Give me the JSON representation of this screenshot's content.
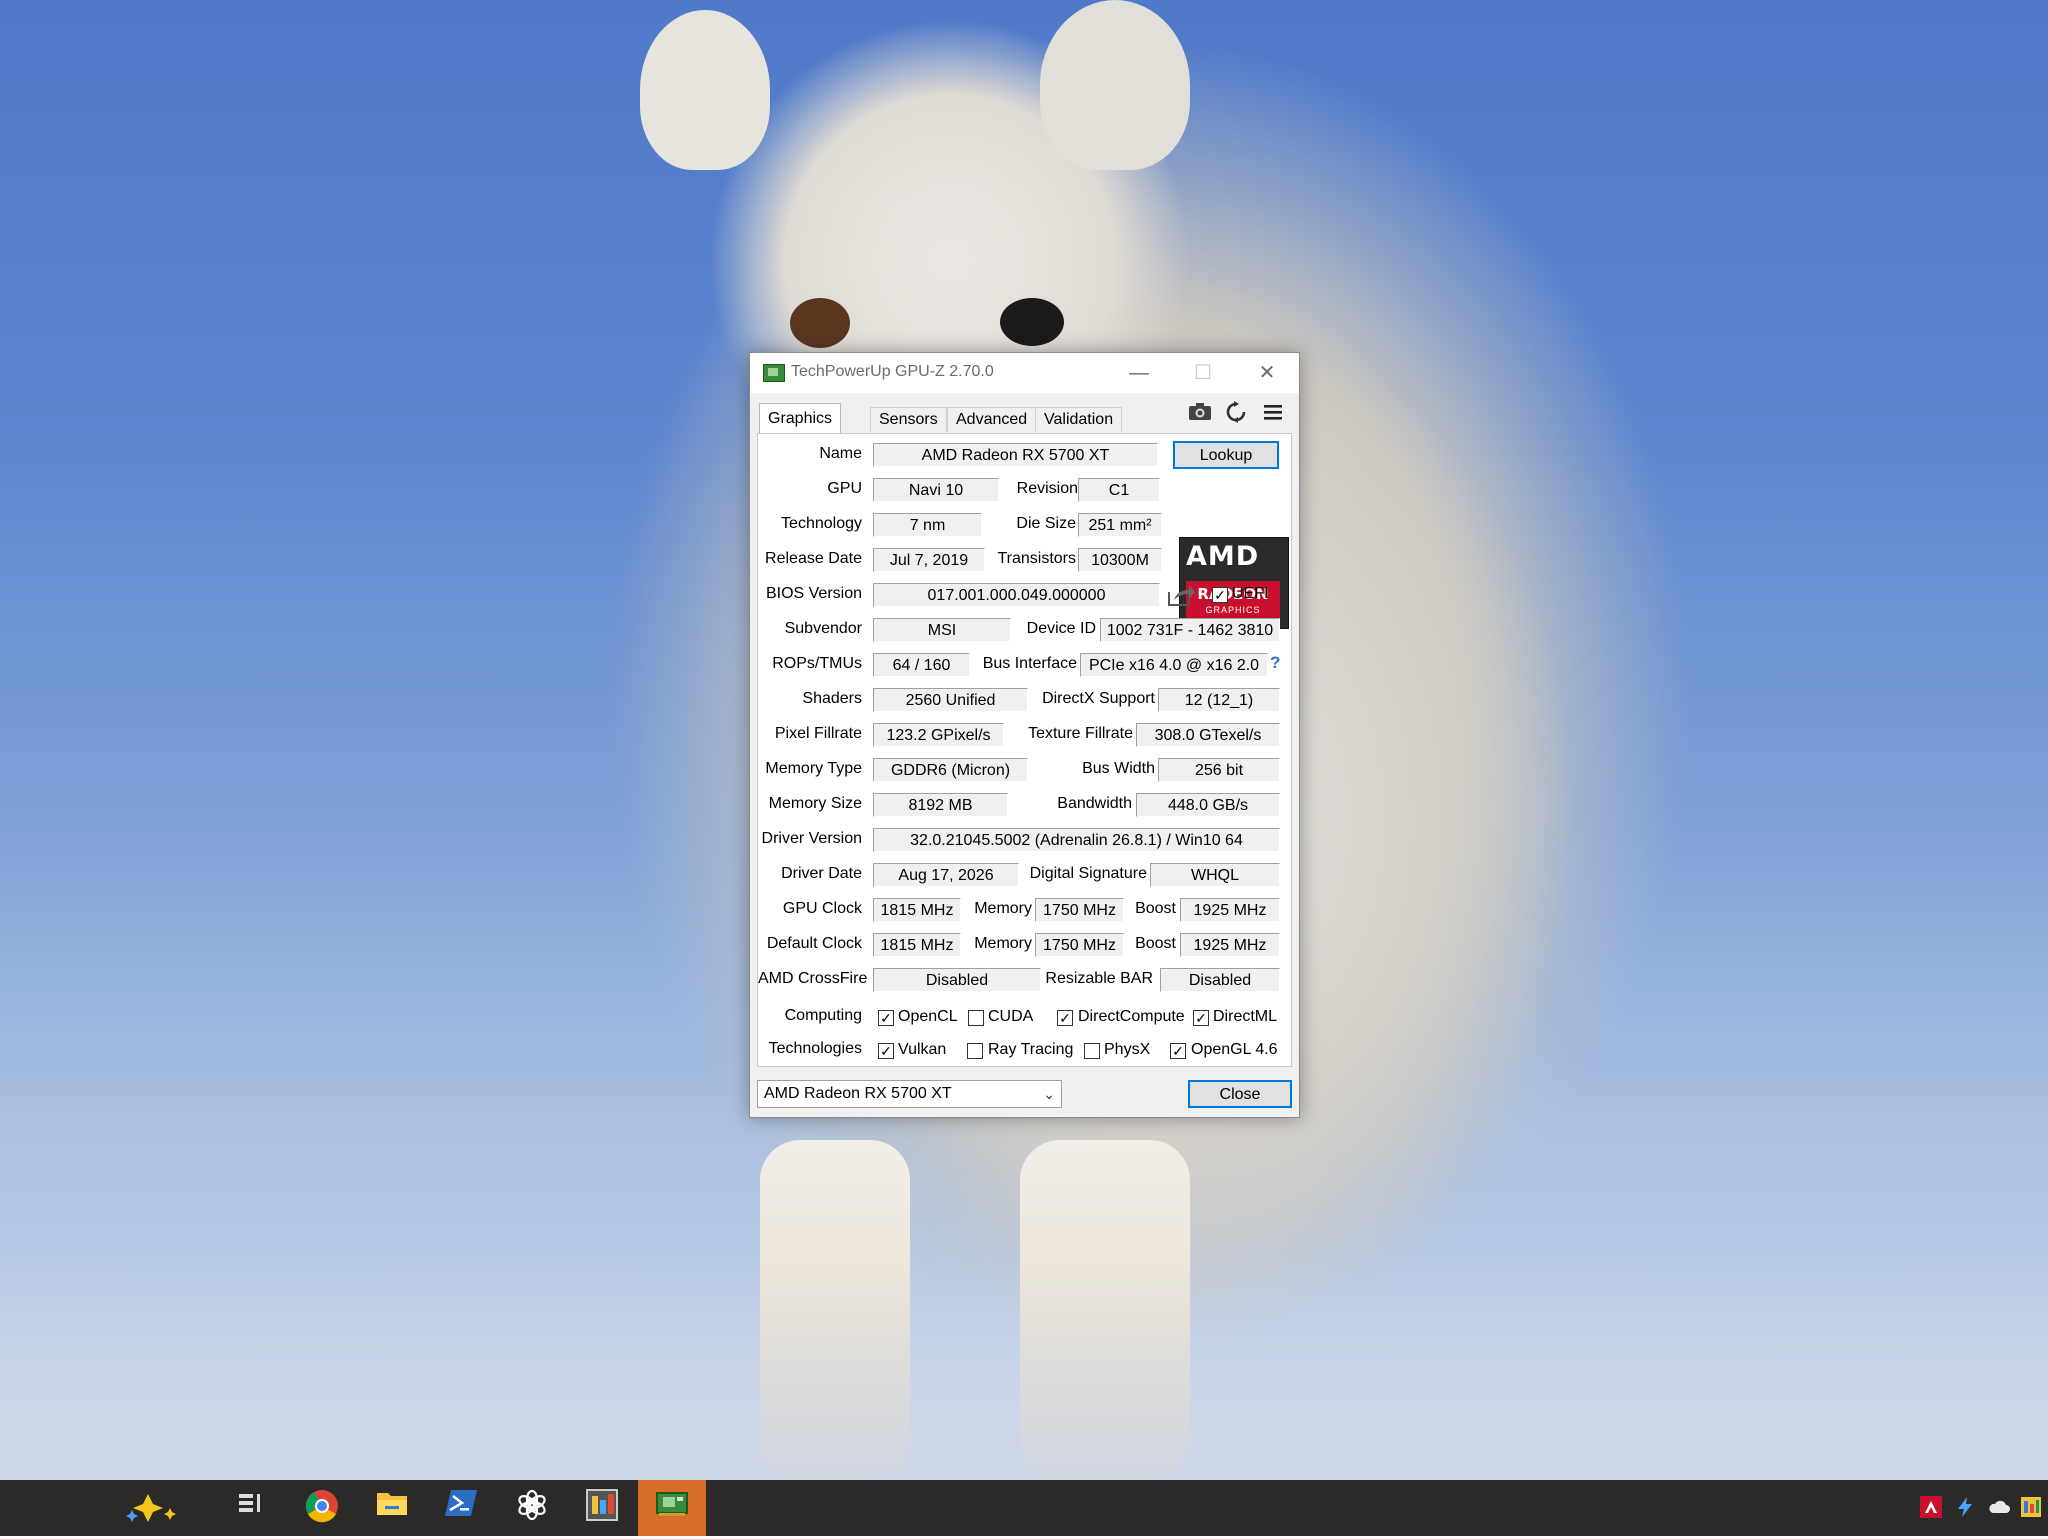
{
  "window": {
    "title": "TechPowerUp GPU-Z 2.70.0",
    "minimize_glyph": "—",
    "maximize_glyph": "☐",
    "close_glyph": "✕"
  },
  "tabs": [
    "Graphics Card",
    "Sensors",
    "Advanced",
    "Validation"
  ],
  "toolbar_icons": [
    "camera-icon",
    "refresh-icon",
    "menu-icon"
  ],
  "fields": {
    "name": {
      "label": "Name",
      "value": "AMD Radeon RX 5700 XT"
    },
    "lookup_button": "Lookup",
    "gpu": {
      "label": "GPU",
      "value": "Navi 10"
    },
    "revision": {
      "label": "Revision",
      "value": "C1"
    },
    "technology": {
      "label": "Technology",
      "value": "7 nm"
    },
    "die_size": {
      "label": "Die Size",
      "value": "251 mm²"
    },
    "release_date": {
      "label": "Release Date",
      "value": "Jul 7, 2019"
    },
    "transistors": {
      "label": "Transistors",
      "value": "10300M"
    },
    "bios_version": {
      "label": "BIOS Version",
      "value": "017.001.000.049.000000"
    },
    "uefi": {
      "label": "UEFI",
      "checked": true
    },
    "subvendor": {
      "label": "Subvendor",
      "value": "MSI"
    },
    "device_id": {
      "label": "Device ID",
      "value": "1002 731F - 1462 3810"
    },
    "rops_tmus": {
      "label": "ROPs/TMUs",
      "value": "64 / 160"
    },
    "bus_interface": {
      "label": "Bus Interface",
      "value": "PCIe x16 4.0 @ x16 2.0",
      "help": "?"
    },
    "shaders": {
      "label": "Shaders",
      "value": "2560 Unified"
    },
    "directx_support": {
      "label": "DirectX Support",
      "value": "12 (12_1)"
    },
    "pixel_fillrate": {
      "label": "Pixel Fillrate",
      "value": "123.2 GPixel/s"
    },
    "texture_fillrate": {
      "label": "Texture Fillrate",
      "value": "308.0 GTexel/s"
    },
    "memory_type": {
      "label": "Memory Type",
      "value": "GDDR6 (Micron)"
    },
    "bus_width": {
      "label": "Bus Width",
      "value": "256 bit"
    },
    "memory_size": {
      "label": "Memory Size",
      "value": "8192 MB"
    },
    "bandwidth": {
      "label": "Bandwidth",
      "value": "448.0 GB/s"
    },
    "driver_version": {
      "label": "Driver Version",
      "value": "32.0.21045.5002 (Adrenalin 26.8.1) / Win10 64"
    },
    "driver_date": {
      "label": "Driver Date",
      "value": "Aug 17, 2026"
    },
    "digital_signature": {
      "label": "Digital Signature",
      "value": "WHQL"
    },
    "gpu_clock": {
      "label": "GPU Clock",
      "value": "1815 MHz",
      "memory_label": "Memory",
      "memory_value": "1750 MHz",
      "boost_label": "Boost",
      "boost_value": "1925 MHz"
    },
    "default_clock": {
      "label": "Default Clock",
      "value": "1815 MHz",
      "memory_label": "Memory",
      "memory_value": "1750 MHz",
      "boost_label": "Boost",
      "boost_value": "1925 MHz"
    },
    "amd_crossfire": {
      "label": "AMD CrossFire",
      "value": "Disabled"
    },
    "resizable_bar": {
      "label": "Resizable BAR",
      "value": "Disabled"
    }
  },
  "computing": {
    "label": "Computing",
    "items": [
      {
        "name": "OpenCL",
        "checked": true
      },
      {
        "name": "CUDA",
        "checked": false
      },
      {
        "name": "DirectCompute",
        "checked": true
      },
      {
        "name": "DirectML",
        "checked": true
      }
    ]
  },
  "technologies": {
    "label": "Technologies",
    "items": [
      {
        "name": "Vulkan",
        "checked": true
      },
      {
        "name": "Ray Tracing",
        "checked": false
      },
      {
        "name": "PhysX",
        "checked": false
      },
      {
        "name": "OpenGL 4.6",
        "checked": true
      }
    ]
  },
  "logo": {
    "brand": "AMD",
    "product": "RADEON",
    "sub": "GRAPHICS"
  },
  "gpu_select": {
    "value": "AMD Radeon RX 5700 XT",
    "arrow": "⌄"
  },
  "close_button": "Close",
  "check_glyph": "✓",
  "taskbar": {
    "icons": [
      "copilot-icon",
      "task-view-icon",
      "chrome-icon",
      "file-explorer-icon",
      "powershell-icon",
      "chatgpt-icon",
      "taskmgr-icon",
      "gpuz-icon"
    ],
    "tray_icons": [
      "amd-tray-icon",
      "flash-tray-icon",
      "cloud-tray-icon",
      "app-tray-icon"
    ]
  },
  "colors": {
    "accent": "#0078d7",
    "taskbar_active": "#d86d2a",
    "amd_red": "#c8102e"
  }
}
